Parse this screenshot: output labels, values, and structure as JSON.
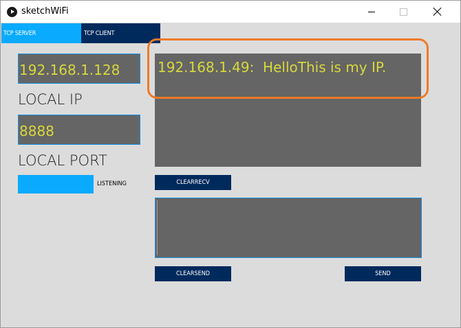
{
  "window": {
    "title": "sketchWiFi",
    "controls": {
      "minimize": "minimize",
      "maximize": "maximize",
      "close": "close"
    }
  },
  "tabs": [
    {
      "label": "TCP SERVER",
      "active": true
    },
    {
      "label": "TCP CLIENT",
      "active": false
    }
  ],
  "local": {
    "ip_value": "192.168.1.128",
    "ip_label": "LOCAL IP",
    "port_value": "8888",
    "port_label": "LOCAL PORT",
    "status_label": "LISTENING"
  },
  "receive": {
    "text": "192.168.1.49:  HelloThis is my IP.",
    "clear_label": "CLEARRECV"
  },
  "send": {
    "value": "",
    "clear_label": "CLEARSEND",
    "send_label": "SEND"
  },
  "colors": {
    "accent": "#0aaaff",
    "dark_button": "#002a5c",
    "text_yellow": "#d8d83c",
    "field_bg": "#656565",
    "highlight": "#ee7a2a"
  }
}
